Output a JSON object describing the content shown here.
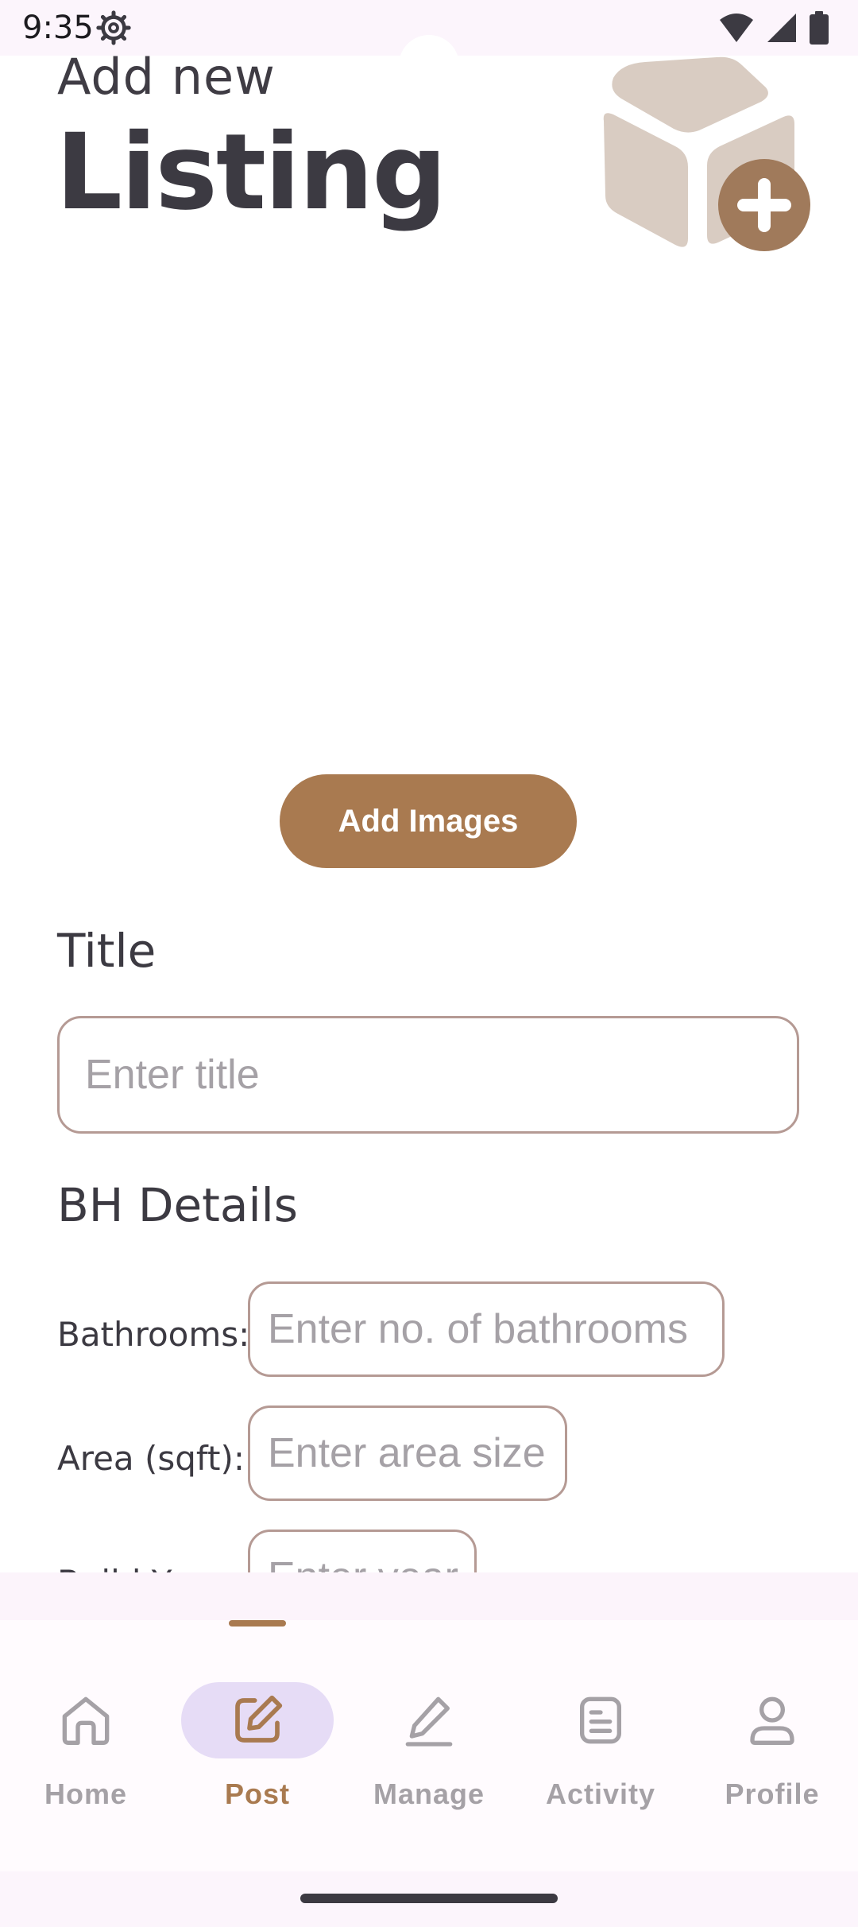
{
  "status_bar": {
    "time": "9:35",
    "icons": [
      "settings-icon",
      "wifi-icon",
      "signal-icon",
      "battery-icon"
    ]
  },
  "header": {
    "subtitle": "Add new",
    "title": "Listing",
    "illustration_icon": "box-add-icon"
  },
  "add_images_button": "Add Images",
  "title_section": {
    "label": "Title",
    "placeholder": "Enter title"
  },
  "details_section": {
    "label": "BH Details",
    "fields": [
      {
        "label": "Bathrooms:",
        "placeholder": "Enter no. of bathrooms"
      },
      {
        "label": "Area (sqft):",
        "placeholder": "Enter area size"
      },
      {
        "label": "Build Year:",
        "placeholder": "Enter year"
      }
    ]
  },
  "bottom_nav": {
    "items": [
      {
        "label": "Home",
        "icon": "home-icon",
        "active": false
      },
      {
        "label": "Post",
        "icon": "edit-square-icon",
        "active": true
      },
      {
        "label": "Manage",
        "icon": "pencil-icon",
        "active": false
      },
      {
        "label": "Activity",
        "icon": "document-list-icon",
        "active": false
      },
      {
        "label": "Profile",
        "icon": "person-icon",
        "active": false
      }
    ]
  },
  "colors": {
    "accent": "#a97a50",
    "text_dark": "#3c3a42",
    "placeholder": "#a5a1a6",
    "field_border": "#b59a94",
    "nav_active_pill": "#e6dcf6"
  }
}
